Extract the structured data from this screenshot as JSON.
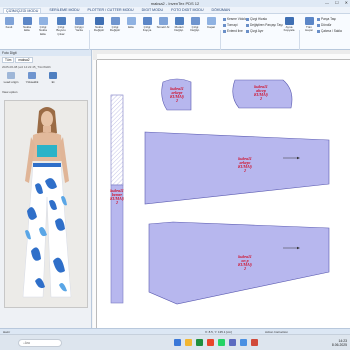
{
  "window": {
    "title": "maksa2 - InvenTex PDS 12",
    "controls": [
      "—",
      "☐",
      "✕"
    ]
  },
  "tabs": [
    "ÇİZİM/ÇİZGİ MODU",
    "SERİLEME MODU",
    "PLOTTER / CUTTER MODU",
    "DIGIT MODU",
    "FOTO DIGIT MODU",
    "DÖKÜMAN"
  ],
  "ribbon": {
    "buttons": [
      "Kesit",
      "Nokta Ekle",
      "Çizgi Nokta Ekle",
      "Çizgi Boyutu Çıkar",
      "Çizgiyi Yarıla",
      "Nokta Değiştir",
      "Çizgi Değiştir",
      "Ekle",
      "Çizgi Kopya",
      "Simetri Al",
      "Modeli Değişt.",
      "Çizgi Değişt.",
      "Kapat",
      "Ayna Kopyala",
      "Tüm Hepsi"
    ],
    "small_items": [
      "Kesme Vidola",
      "Tornapi",
      "Extend line",
      "Çizgi Hizala",
      "Değiştiren Parçayı Taşı",
      "Çizgi Ayır",
      "Parça Taşı",
      "Döndür",
      "Çakma / Sakla"
    ],
    "groups": [
      "Kesit",
      "Çizgi Düzenle",
      "Seçenek"
    ]
  },
  "left_panel": {
    "title": "Foto Digit",
    "tabs": [
      "Tüm",
      "maksa2"
    ],
    "path": "2025-06-08 (wd 14:22:45_TrimWidth",
    "tools": [
      "Load origin",
      "Yükseklik",
      "Et"
    ],
    "option_label": "View option",
    "photo_alt": "model photo"
  },
  "pieces": [
    {
      "lines": [
        "kubra11",
        "arkepr",
        "KUMAŞ",
        "2"
      ]
    },
    {
      "lines": [
        "kubra11",
        "ahcep",
        "KUMAŞ",
        "2"
      ]
    },
    {
      "lines": [
        "kubra11",
        "arkepc",
        "KUMAŞ",
        "2"
      ]
    },
    {
      "lines": [
        "kubra11",
        "bemer",
        "KUMAŞ",
        "2"
      ]
    },
    {
      "lines": [
        "kubra11",
        "on p",
        "KUMAŞ",
        "2"
      ]
    }
  ],
  "status": {
    "left": "Hazır",
    "coord": "X: 8.5, Y: 135.1 [cm]",
    "action": "Action Instruction"
  },
  "taskbar": {
    "search_placeholder": "Ara",
    "time": "14:23",
    "date": "8.06.2025"
  },
  "colors": {
    "piece_fill": "#b7b7ee",
    "piece_label": "#d0102a",
    "accent": "#1d3f73"
  }
}
